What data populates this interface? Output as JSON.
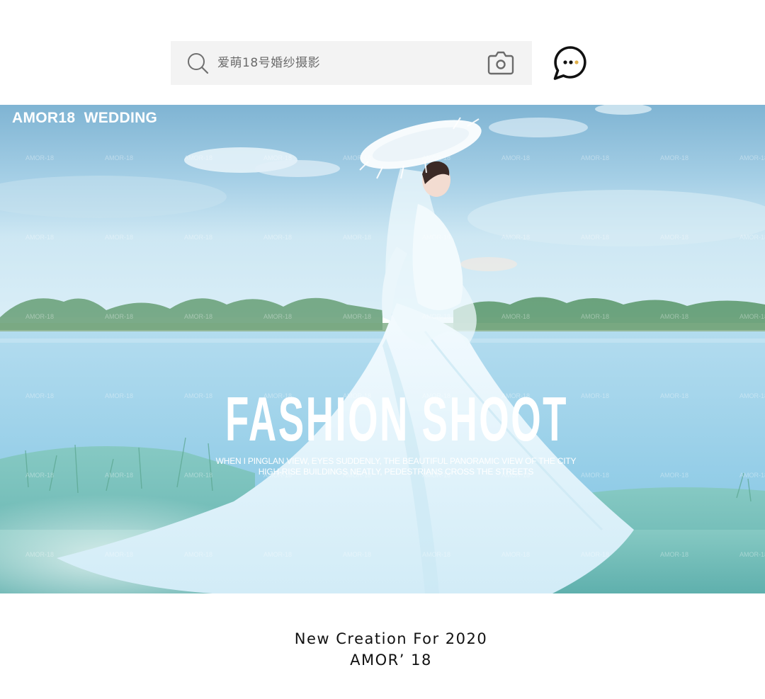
{
  "search": {
    "placeholder": "爱萌18号婚纱摄影"
  },
  "icons": {
    "search": "search-icon",
    "camera": "camera-icon",
    "message": "chat-bubble-icon"
  },
  "hero": {
    "brand": "AMOR18  WEDDING",
    "headline": "FASHION SHOOT",
    "sub_line_1": "WHEN I PINGLAN VIEW, EYES SUDDENLY, THE BEAUTIFUL PANORAMIC VIEW OF THE CITY",
    "sub_line_2": "HIGH-RISE BUILDINGS NEATLY, PEDESTRIANS CROSS THE STREETS",
    "watermark": "AMOR-18"
  },
  "footer": {
    "line_1": "New Creation For 2020",
    "line_2": "AMOR’ 18"
  },
  "colors": {
    "sky": "#a9d4ea",
    "water": "#a8d7ec",
    "grass": "#7fc4c2",
    "dress": "#e9f6fc"
  }
}
